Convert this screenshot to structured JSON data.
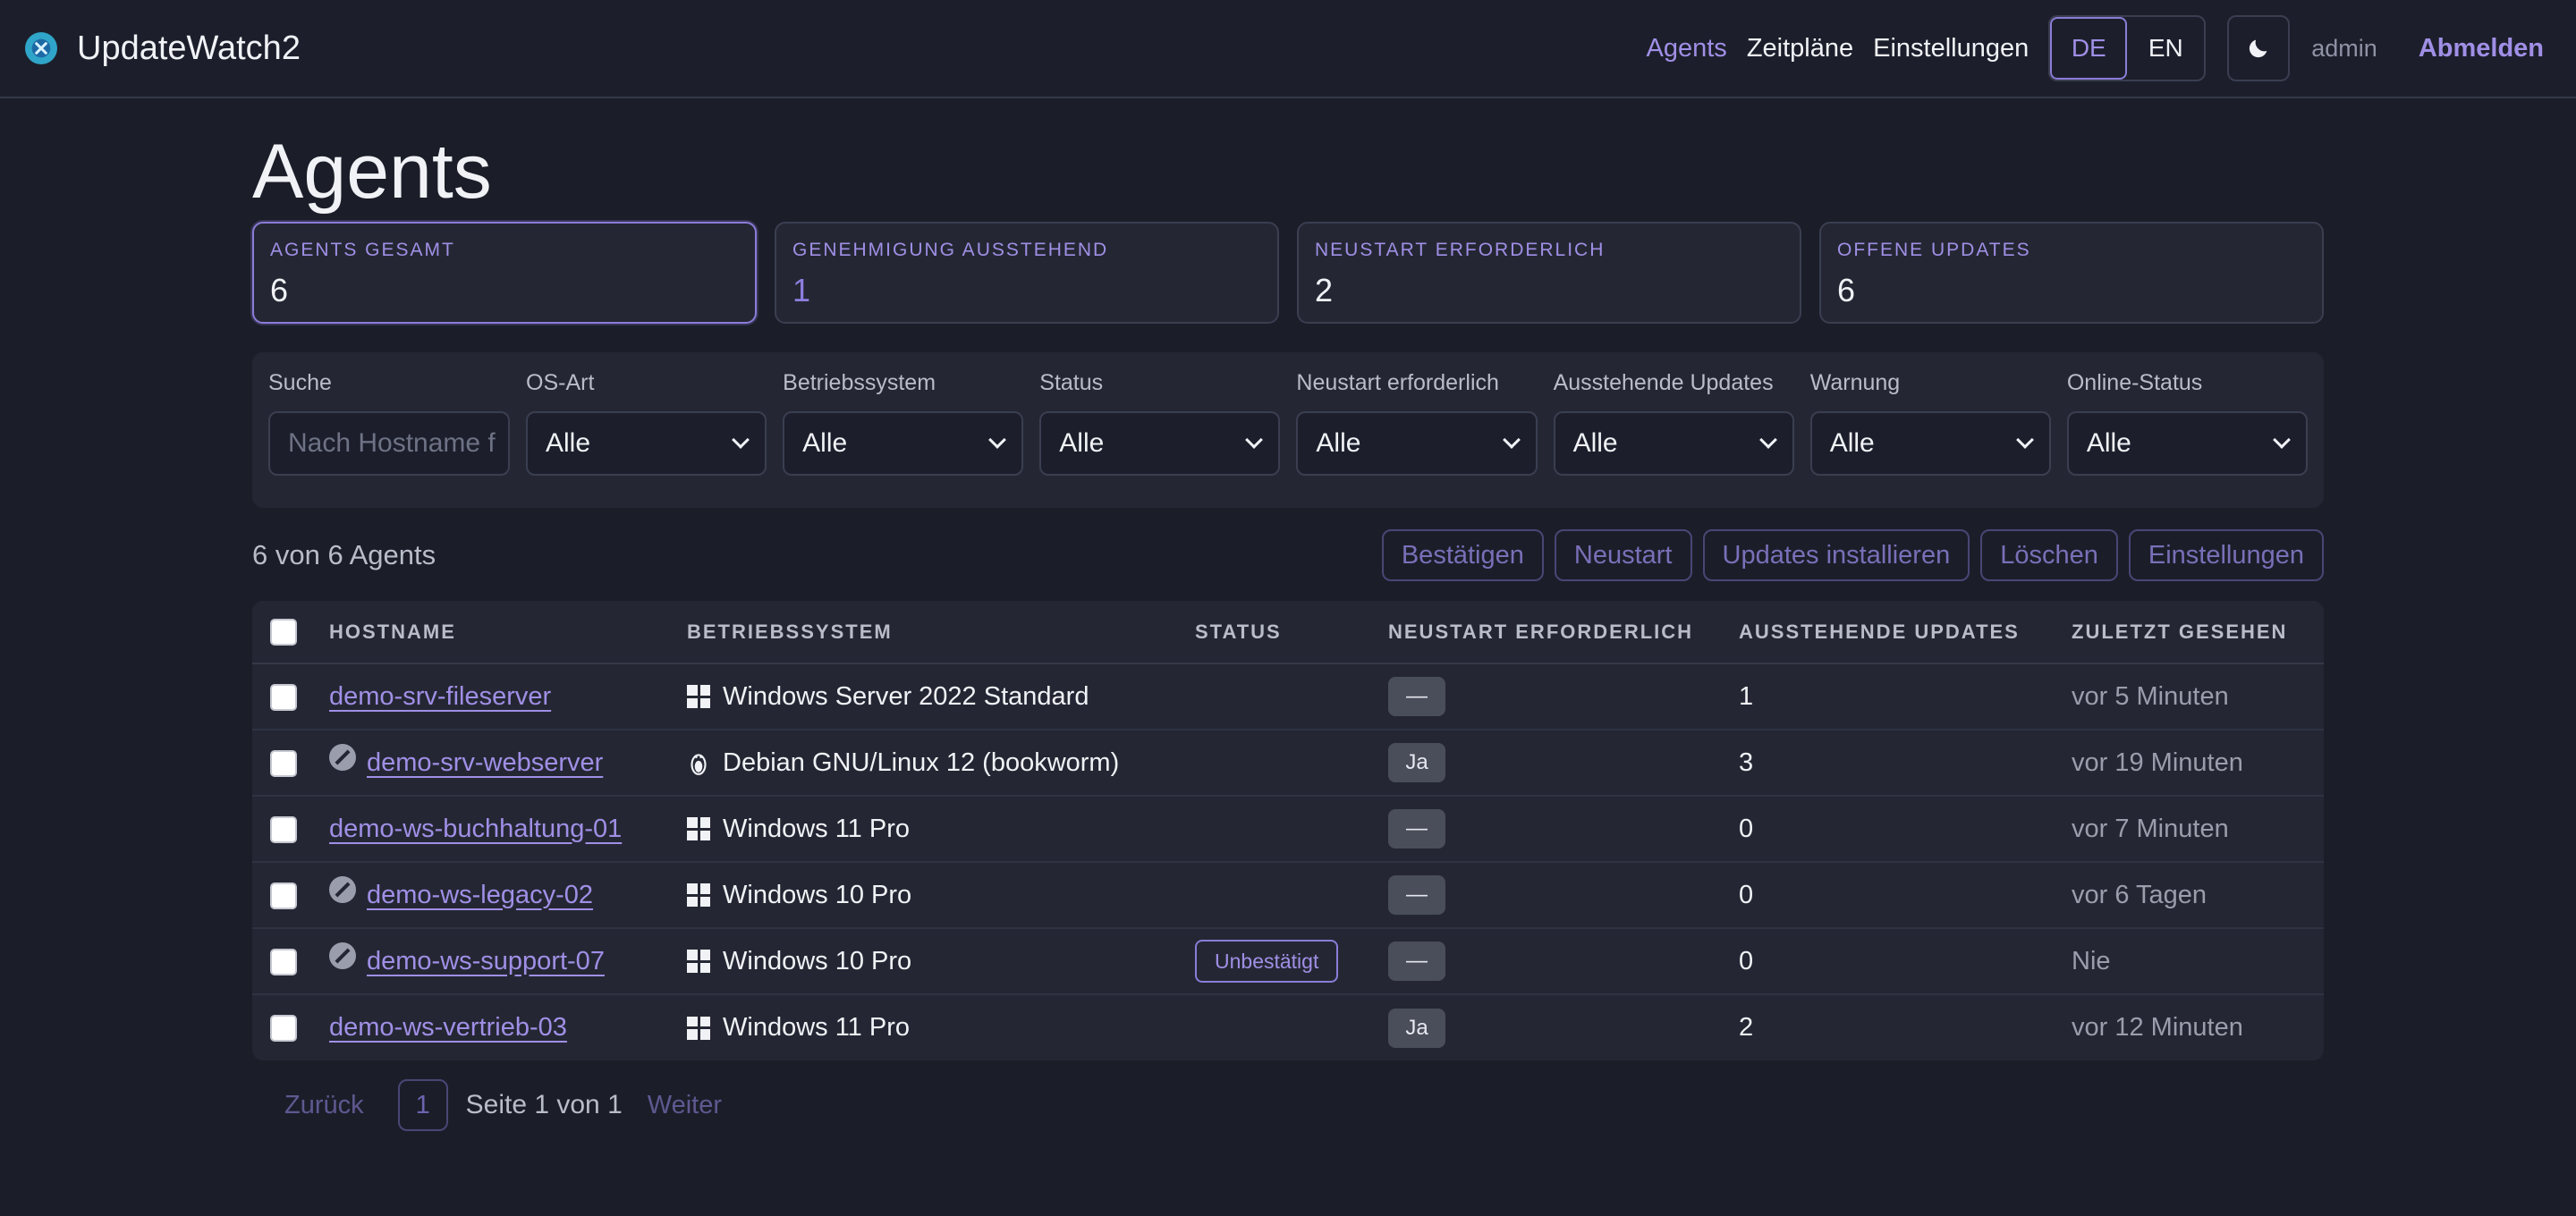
{
  "app": {
    "name": "UpdateWatch2"
  },
  "nav": {
    "links": [
      "Agents",
      "Zeitpläne",
      "Einstellungen"
    ],
    "lang": [
      "DE",
      "EN"
    ],
    "user": "admin",
    "logout": "Abmelden"
  },
  "page": {
    "title": "Agents"
  },
  "stats": [
    {
      "label": "Agents gesamt",
      "value": "6"
    },
    {
      "label": "Genehmigung ausstehend",
      "value": "1"
    },
    {
      "label": "Neustart erforderlich",
      "value": "2"
    },
    {
      "label": "Offene Updates",
      "value": "6"
    }
  ],
  "filters": {
    "search_label": "Suche",
    "search_placeholder": "Nach Hostname f",
    "selects": [
      {
        "label": "OS-Art",
        "value": "Alle"
      },
      {
        "label": "Betriebssystem",
        "value": "Alle"
      },
      {
        "label": "Status",
        "value": "Alle"
      },
      {
        "label": "Neustart erforderlich",
        "value": "Alle"
      },
      {
        "label": "Ausstehende Updates",
        "value": "Alle"
      },
      {
        "label": "Warnung",
        "value": "Alle"
      },
      {
        "label": "Online-Status",
        "value": "Alle"
      }
    ]
  },
  "toolbar": {
    "count": "6 von 6 Agents",
    "actions": [
      "Bestätigen",
      "Neustart",
      "Updates installieren",
      "Löschen",
      "Einstellungen"
    ]
  },
  "table": {
    "headers": [
      "Hostname",
      "Betriebssystem",
      "Status",
      "Neustart erforderlich",
      "Ausstehende Updates",
      "Zuletzt gesehen"
    ],
    "rows": [
      {
        "host": "demo-srv-fileserver",
        "os": "Windows Server 2022 Standard",
        "os_icon": "windows-icon",
        "status": "",
        "reboot": "—",
        "updates": "1",
        "seen": "vor 5 Minuten",
        "disabled": false
      },
      {
        "host": "demo-srv-webserver",
        "os": "Debian GNU/Linux 12 (bookworm)",
        "os_icon": "linux-icon",
        "status": "",
        "reboot": "Ja",
        "updates": "3",
        "seen": "vor 19 Minuten",
        "disabled": true
      },
      {
        "host": "demo-ws-buchhaltung-01",
        "os": "Windows 11 Pro",
        "os_icon": "windows-icon",
        "status": "",
        "reboot": "—",
        "updates": "0",
        "seen": "vor 7 Minuten",
        "disabled": false
      },
      {
        "host": "demo-ws-legacy-02",
        "os": "Windows 10 Pro",
        "os_icon": "windows-icon",
        "status": "",
        "reboot": "—",
        "updates": "0",
        "seen": "vor 6 Tagen",
        "disabled": true
      },
      {
        "host": "demo-ws-support-07",
        "os": "Windows 10 Pro",
        "os_icon": "windows-icon",
        "status": "Unbestätigt",
        "reboot": "—",
        "updates": "0",
        "seen": "Nie",
        "disabled": true
      },
      {
        "host": "demo-ws-vertrieb-03",
        "os": "Windows 11 Pro",
        "os_icon": "windows-icon",
        "status": "",
        "reboot": "Ja",
        "updates": "2",
        "seen": "vor 12 Minuten",
        "disabled": false
      }
    ]
  },
  "pagination": {
    "prev": "Zurück",
    "page": "1",
    "info": "Seite 1 von 1",
    "next": "Weiter"
  },
  "colors": {
    "accent": "#a08fe6",
    "background": "#1b1e29",
    "card": "#242733"
  }
}
